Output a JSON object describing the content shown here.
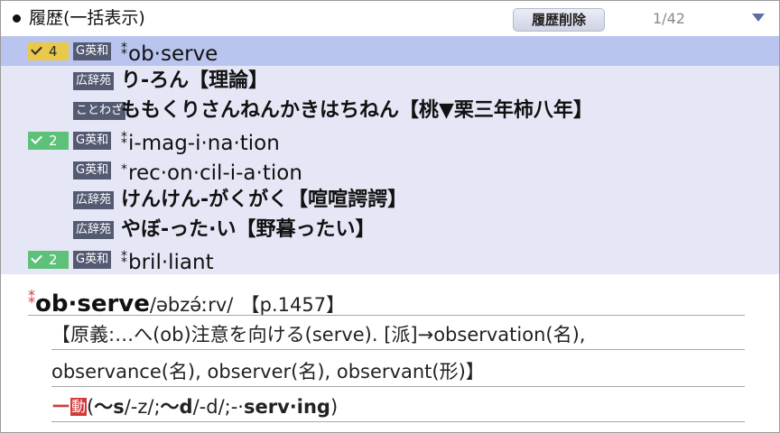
{
  "header": {
    "title": "履歴(一括表示)",
    "delete_label": "履歴削除",
    "pager": "1/42"
  },
  "history": [
    {
      "check": "4",
      "check_color": "#eac94a",
      "badge": "G英和",
      "asterisk": "⁑",
      "text": "ob·serve",
      "selected": true
    },
    {
      "check": "",
      "badge": "広辞苑",
      "asterisk": "",
      "text": "り-ろん【理論】"
    },
    {
      "check": "",
      "badge": "ことわざ",
      "asterisk": "",
      "text": "ももくりさんねんかきはちねん【桃▼栗三年柿八年】"
    },
    {
      "check": "2",
      "check_color": "#5ec17a",
      "badge": "G英和",
      "asterisk": "⁑",
      "text": "i-mag-i·na·tion"
    },
    {
      "check": "",
      "badge": "G英和",
      "asterisk": "*",
      "text": "rec·on·cil-i-a·tion"
    },
    {
      "check": "",
      "badge": "広辞苑",
      "asterisk": "",
      "text": "けんけん-がくがく【喧喧諤諤】"
    },
    {
      "check": "",
      "badge": "広辞苑",
      "asterisk": "",
      "text": "やぼ-った·い【野暮ったい】"
    },
    {
      "check": "2",
      "check_color": "#5ec17a",
      "badge": "G英和",
      "asterisk": "⁑",
      "text": "bril·liant"
    }
  ],
  "detail": {
    "asterisk": "⁑",
    "headword": "ob·serve",
    "pronunciation": "/əbzə́ːrv/",
    "page_ref": "【p.1457】",
    "line1": "【原義:…へ(ob)注意を向ける(serve). [派]→observation(名),",
    "line2": "observance(名), observer(名), observant(形)】",
    "pos_dash": "ー",
    "pos_label": "動",
    "infl_open": "(",
    "infl_s": "〜s",
    "infl_z": "/-z/;",
    "infl_d": "〜d",
    "infl_dd": "/-d/;",
    "infl_ing_prefix": "-·",
    "infl_ing": "serv·ing",
    "infl_close": ")"
  },
  "colors": {
    "selected_row": "#b9c5ee",
    "list_bg": "#e6e7f6",
    "badge_bg": "#555a73",
    "accent_red": "#d23a3a"
  },
  "icons": [
    "bullet-dot-icon",
    "dropdown-arrow-icon",
    "checkmark-icon"
  ]
}
